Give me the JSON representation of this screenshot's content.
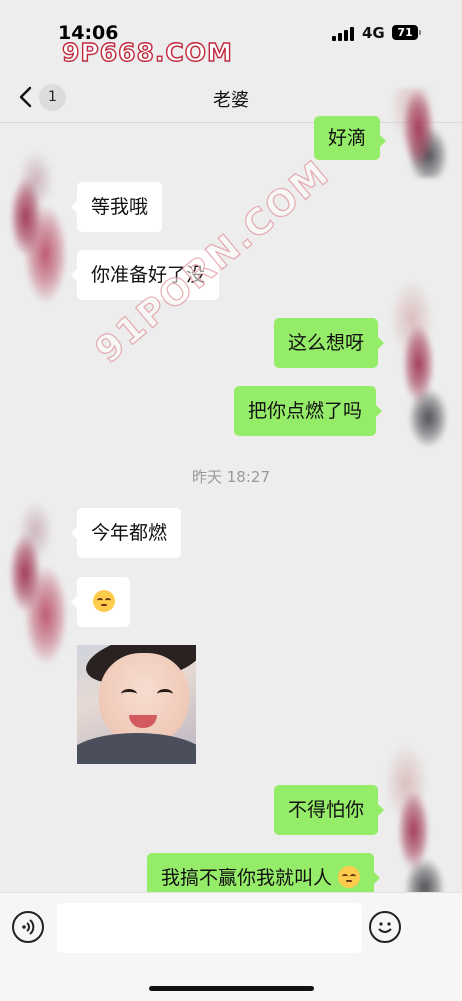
{
  "status_bar": {
    "time": "14:06",
    "network": "4G",
    "battery": "71",
    "watermark": "9P668.COM"
  },
  "nav": {
    "title": "老婆",
    "unread_count": "1"
  },
  "watermark_center": "91PORN.COM",
  "messages": [
    {
      "side": "out",
      "text": "好滴"
    },
    {
      "side": "in",
      "text": "等我哦"
    },
    {
      "side": "in",
      "text": "你准备好了没"
    },
    {
      "side": "out",
      "text": "这么想呀"
    },
    {
      "side": "out",
      "text": "把你点燃了吗"
    },
    {
      "side": "in",
      "text": "今年都燃"
    },
    {
      "side": "in",
      "text": "",
      "emoji": "smirk-face"
    },
    {
      "side": "in",
      "image": "baby-photo"
    },
    {
      "side": "out",
      "text": "不得怕你"
    },
    {
      "side": "out",
      "text": "我搞不赢你我就叫人",
      "emoji": "smirk-face"
    }
  ],
  "timestamp": "昨天 18:27",
  "input_bar": {
    "placeholder": ""
  },
  "colors": {
    "background": "#ededed",
    "outgoing_bubble": "#95ec69",
    "incoming_bubble": "#ffffff",
    "watermark": "#c0283c"
  }
}
